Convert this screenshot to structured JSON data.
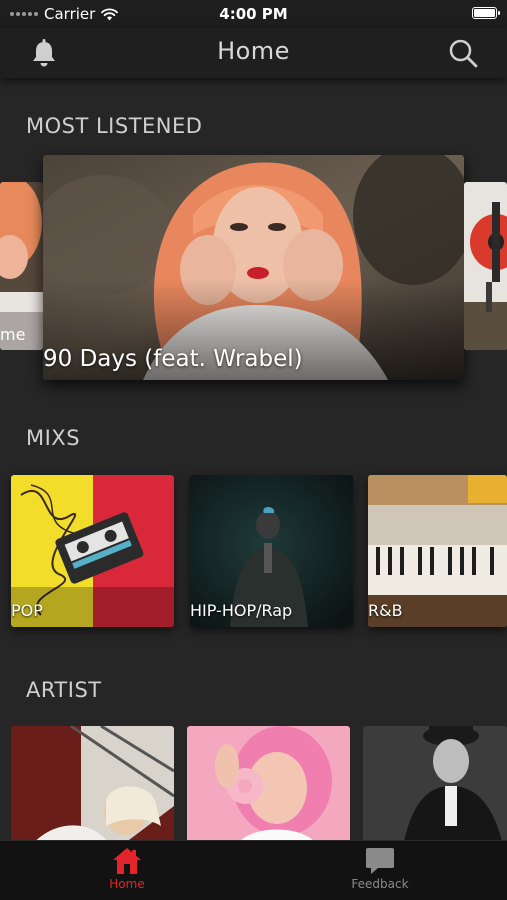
{
  "status_bar": {
    "carrier": "Carrier",
    "time": "4:00 PM"
  },
  "nav": {
    "title": "Home",
    "left_icon": "bell-icon",
    "right_icon": "search-icon"
  },
  "most_listened": {
    "title": "MOST LISTENED",
    "cards": [
      {
        "caption": "me"
      },
      {
        "caption": "90 Days (feat. Wrabel)"
      },
      {
        "caption": ""
      }
    ]
  },
  "mixs": {
    "title": "MIXS",
    "items": [
      {
        "label": "POP"
      },
      {
        "label": "HIP-HOP/Rap"
      },
      {
        "label": "R&B"
      }
    ]
  },
  "artist": {
    "title": "ARTIST",
    "items": [
      {},
      {},
      {}
    ]
  },
  "tab_bar": {
    "items": [
      {
        "label": "Home",
        "icon": "home-icon",
        "active": true
      },
      {
        "label": "Feedback",
        "icon": "chat-bubble-icon",
        "active": false
      }
    ]
  },
  "colors": {
    "accent": "#e3242b",
    "background": "#262626",
    "bar": "#1f1f1f"
  }
}
